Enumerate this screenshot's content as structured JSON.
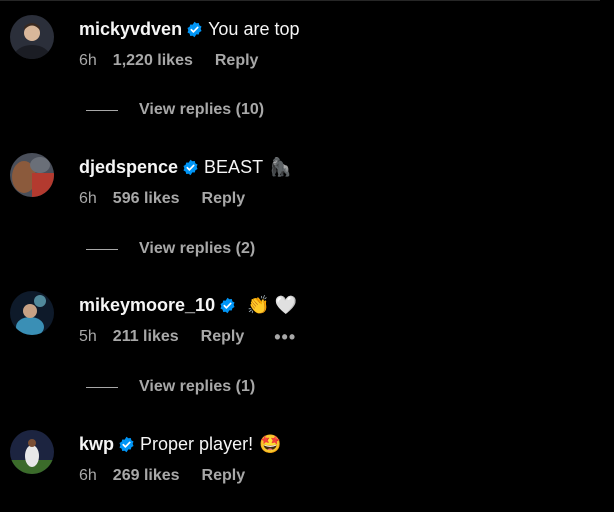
{
  "comments": [
    {
      "username": "mickyvdven",
      "text": "You are top",
      "emoji": "",
      "time": "6h",
      "likes": "1,220 likes",
      "reply": "Reply",
      "view_replies": "View replies (10)",
      "avatar_colors": [
        "#2b2f3a",
        "#d8b79a",
        "#1b1d24"
      ]
    },
    {
      "username": "djedspence",
      "text": "BEAST",
      "emoji": "🦍",
      "time": "6h",
      "likes": "596 likes",
      "reply": "Reply",
      "view_replies": "View replies (2)",
      "avatar_colors": [
        "#4a4f5a",
        "#8b5a3c",
        "#b33a2f"
      ]
    },
    {
      "username": "mikeymoore_10",
      "text": "",
      "emoji": "👏 🤍",
      "time": "5h",
      "likes": "211 likes",
      "reply": "Reply",
      "more": "•••",
      "view_replies": "View replies (1)",
      "avatar_colors": [
        "#0e1a2a",
        "#3a8fb5",
        "#7fd3e8"
      ]
    },
    {
      "username": "kwp",
      "text": "Proper player!",
      "emoji": "🤩",
      "time": "6h",
      "likes": "269 likes",
      "reply": "Reply",
      "avatar_colors": [
        "#1c2440",
        "#e8e8e8",
        "#3b6b2a"
      ]
    }
  ],
  "colors": {
    "background": "#000000",
    "primary_text": "#f5f5f5",
    "secondary_text": "#a8a8a8",
    "verified_blue": "#0095f6"
  }
}
